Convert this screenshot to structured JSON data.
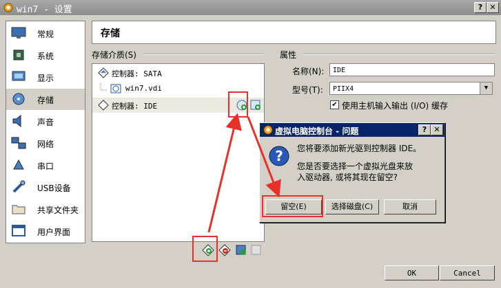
{
  "window": {
    "title": "win7 - 设置",
    "help_label": "?",
    "close_label": "✕"
  },
  "sidebar": {
    "items": [
      {
        "label": "常规",
        "icon": "monitor-icon"
      },
      {
        "label": "系统",
        "icon": "chip-icon"
      },
      {
        "label": "显示",
        "icon": "display-icon"
      },
      {
        "label": "存储",
        "icon": "disk-icon"
      },
      {
        "label": "声音",
        "icon": "speaker-icon"
      },
      {
        "label": "网络",
        "icon": "network-icon"
      },
      {
        "label": "串口",
        "icon": "serial-icon"
      },
      {
        "label": "USB设备",
        "icon": "usb-icon"
      },
      {
        "label": "共享文件夹",
        "icon": "folder-icon"
      },
      {
        "label": "用户界面",
        "icon": "ui-icon"
      }
    ],
    "selected": "存储"
  },
  "header": {
    "title": "存储"
  },
  "storage": {
    "group_label": "存储介质(S)",
    "tree": [
      {
        "label": "控制器: SATA",
        "kind": "controller"
      },
      {
        "label": "win7.vdi",
        "kind": "disk"
      },
      {
        "label": "控制器: IDE",
        "kind": "controller",
        "selected": true
      }
    ]
  },
  "attributes": {
    "group_label": "属性",
    "name_label": "名称(N):",
    "name_value": "IDE",
    "type_label": "型号(T):",
    "type_value": "PIIX4",
    "hostio_label": "使用主机输入输出 (I/O) 缓存",
    "hostio_checked": "✔"
  },
  "dialog": {
    "title": "虚拟电脑控制台 - 问题",
    "help_label": "?",
    "close_label": "✕",
    "line1": "您将要添加新光驱到控制器 IDE。",
    "line2": "您是否要选择一个虚拟光盘来放入驱动器, 或将其现在留空?",
    "btn_leave_empty": "留空(E)",
    "btn_choose_disk": "选择磁盘(C)",
    "btn_cancel": "取消"
  },
  "footer": {
    "ok_label": "OK",
    "cancel_label": "Cancel"
  },
  "colors": {
    "annotation_red": "#e8302a",
    "dialog_title": "#0a246a"
  }
}
